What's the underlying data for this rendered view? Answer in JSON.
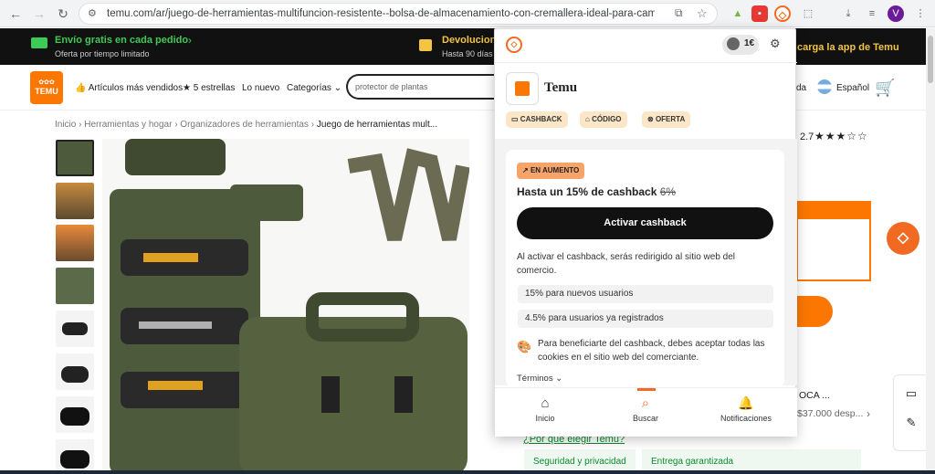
{
  "browser": {
    "url": "temu.com/ar/juego-de-herramientas-multifuncion-resistente--bolsa-de-almacenamiento-con-cremallera-ideal-para-camping-jardin...",
    "profile_initial": "V"
  },
  "promo": {
    "shipping_title": "Envío gratis en cada pedido",
    "shipping_sub": "Oferta por tiempo limitado",
    "returns_title": "Devolucion",
    "returns_sub": "Hasta 90 días",
    "app_text": "carga la app de Temu"
  },
  "header": {
    "logo_text": "TEMU",
    "best_sellers": "Artículos más vendidos",
    "five_stars": "5 estrellas",
    "new": "Lo nuevo",
    "categories": "Categorías",
    "search_placeholder": "protector de plantas",
    "help_partial": "da",
    "language": "Español"
  },
  "breadcrumb": {
    "home": "Inicio",
    "cat1": "Herramientas y hogar",
    "cat2": "Organizadores de herramientas",
    "current": "Juego de herramientas mult..."
  },
  "product_right": {
    "rating_partial": "2.7",
    "seller_partial": "OCA ...",
    "sold_partial": "$37.000 desp...",
    "why_choose": "¿Por qué elegir Temu?",
    "security": "Seguridad y privacidad",
    "delivery": "Entrega garantizada"
  },
  "popup": {
    "balance": "1€",
    "store_name": "Temu",
    "tags": [
      "CASHBACK",
      "CÓDIGO",
      "OFERTA"
    ],
    "badge": "EN AUMENTO",
    "headline": "Hasta un 15% de cashback",
    "old_rate": "6%",
    "activate_button": "Activar cashback",
    "info": "Al activar el cashback, serás redirigido al sitio web del comercio.",
    "rates": [
      "15% para nuevos usuarios",
      "4.5% para usuarios ya registrados"
    ],
    "cookie_note": "Para beneficiarte del cashback, debes aceptar todas las cookies en el sitio web del comerciante.",
    "terms": "Términos",
    "nav": [
      "Inicio",
      "Buscar",
      "Notificaciones"
    ]
  },
  "colors": {
    "temu_orange": "#fb7701",
    "popup_accent": "#f26a21",
    "tag_bg": "#fbe7c8",
    "bag_green": "#4d5a3c"
  }
}
